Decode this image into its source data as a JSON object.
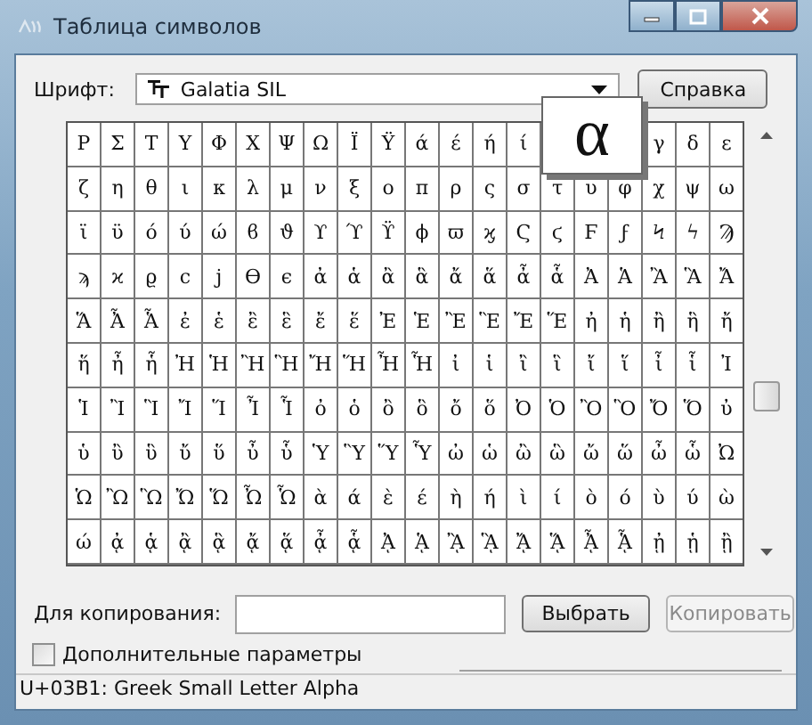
{
  "window": {
    "title": "Таблица символов"
  },
  "font": {
    "label": "Шрифт:",
    "value": "Galatia SIL"
  },
  "help_button": "Справка",
  "grid": {
    "rows": [
      [
        "Ρ",
        "Σ",
        "Τ",
        "Υ",
        "Φ",
        "Χ",
        "Ψ",
        "Ω",
        "Ϊ",
        "Ϋ",
        "ά",
        "έ",
        "ή",
        "ί",
        null,
        null,
        null,
        "γ",
        "δ",
        "ε"
      ],
      [
        "ζ",
        "η",
        "θ",
        "ι",
        "κ",
        "λ",
        "μ",
        "ν",
        "ξ",
        "ο",
        "π",
        "ρ",
        "ς",
        "σ",
        "τ",
        "υ",
        "φ",
        "χ",
        "ψ",
        "ω"
      ],
      [
        "ϊ",
        "ϋ",
        "ό",
        "ύ",
        "ώ",
        "ϐ",
        "ϑ",
        "ϒ",
        "ϓ",
        "ϔ",
        "ϕ",
        "ϖ",
        "ϗ",
        "Ϛ",
        "ϛ",
        "Ϝ",
        "ϝ",
        "Ϟ",
        "ϟ",
        "Ϡ"
      ],
      [
        "ϡ",
        "ϰ",
        "ϱ",
        "ϲ",
        "ϳ",
        "ϴ",
        "ϵ",
        "ἀ",
        "ἁ",
        "ἂ",
        "ἃ",
        "ἄ",
        "ἅ",
        "ἆ",
        "ἇ",
        "Ἀ",
        "Ἁ",
        "Ἂ",
        "Ἃ",
        "Ἄ"
      ],
      [
        "Ἅ",
        "Ἆ",
        "Ἇ",
        "ἐ",
        "ἑ",
        "ἒ",
        "ἓ",
        "ἔ",
        "ἕ",
        "Ἐ",
        "Ἑ",
        "Ἒ",
        "Ἓ",
        "Ἔ",
        "Ἕ",
        "ἠ",
        "ἡ",
        "ἢ",
        "ἣ",
        "ἤ"
      ],
      [
        "ἥ",
        "ἦ",
        "ἧ",
        "Ἠ",
        "Ἡ",
        "Ἢ",
        "Ἣ",
        "Ἤ",
        "Ἥ",
        "Ἦ",
        "Ἧ",
        "ἰ",
        "ἱ",
        "ἲ",
        "ἳ",
        "ἴ",
        "ἵ",
        "ἶ",
        "ἷ",
        "Ἰ"
      ],
      [
        "Ἱ",
        "Ἲ",
        "Ἳ",
        "Ἴ",
        "Ἵ",
        "Ἶ",
        "Ἷ",
        "ὀ",
        "ὁ",
        "ὂ",
        "ὃ",
        "ὄ",
        "ὅ",
        "Ὀ",
        "Ὁ",
        "Ὂ",
        "Ὃ",
        "Ὄ",
        "Ὅ",
        "ὐ"
      ],
      [
        "ὑ",
        "ὒ",
        "ὓ",
        "ὔ",
        "ὕ",
        "ὖ",
        "ὗ",
        "Ὑ",
        "Ὓ",
        "Ὕ",
        "Ὗ",
        "ὠ",
        "ὡ",
        "ὢ",
        "ὣ",
        "ὤ",
        "ὥ",
        "ὦ",
        "ὧ",
        "Ὠ"
      ],
      [
        "Ὡ",
        "Ὢ",
        "Ὣ",
        "Ὤ",
        "Ὥ",
        "Ὦ",
        "Ὧ",
        "ὰ",
        "ά",
        "ὲ",
        "έ",
        "ὴ",
        "ή",
        "ὶ",
        "ί",
        "ὸ",
        "ό",
        "ὺ",
        "ύ",
        "ὼ"
      ],
      [
        "ώ",
        "ᾀ",
        "ᾁ",
        "ᾂ",
        "ᾃ",
        "ᾄ",
        "ᾅ",
        "ᾆ",
        "ᾇ",
        "ᾈ",
        "ᾉ",
        "ᾊ",
        "ᾋ",
        "ᾌ",
        "ᾍ",
        "ᾎ",
        "ᾏ",
        "ᾐ",
        "ᾑ",
        "ᾒ"
      ]
    ],
    "magnified": "α"
  },
  "copy": {
    "label": "Для копирования:",
    "select_button": "Выбрать",
    "copy_button": {
      "label": "Копировать",
      "disabled": true
    }
  },
  "advanced": {
    "label": "Дополнительные параметры",
    "checked": false
  },
  "status_bar": "U+03B1: Greek Small Letter Alpha"
}
